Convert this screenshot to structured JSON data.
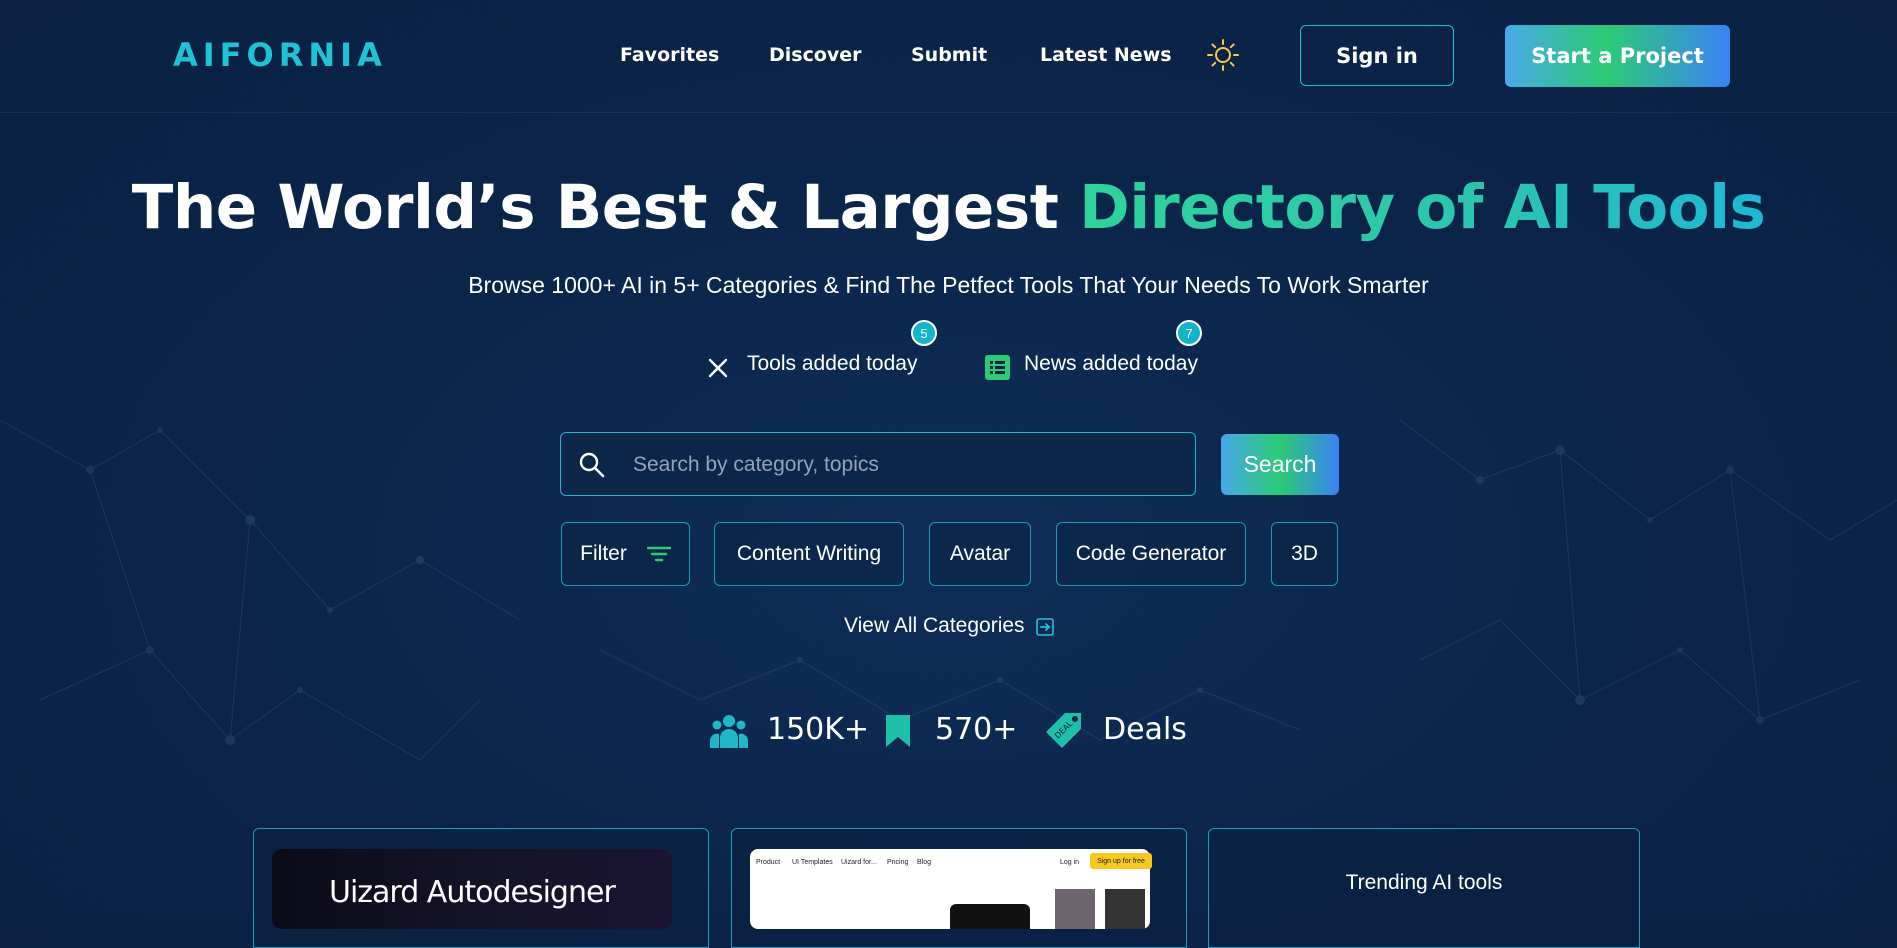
{
  "brand": {
    "logo": "AIFORNIA"
  },
  "nav": {
    "items": [
      "Favorites",
      "Discover",
      "Submit",
      "Latest News"
    ],
    "sign_in": "Sign in",
    "start_project": "Start a Project"
  },
  "hero": {
    "title_prefix": "The World’s Best & Largest ",
    "title_highlight": "Directory of AI Tools",
    "subtitle": "Browse 1000+ AI in 5+ Categories & Find The Petfect Tools That Your Needs To Work Smarter"
  },
  "today": {
    "tools_label": "Tools added today",
    "tools_count": "5",
    "news_label": "News added today",
    "news_count": "7"
  },
  "search": {
    "placeholder": "Search by category, topics",
    "button": "Search"
  },
  "chips": {
    "filter": "Filter",
    "items": [
      "Content Writing",
      "Avatar",
      "Code Generator",
      "3D"
    ]
  },
  "view_all": "View All Categories",
  "stats": {
    "users": "150K+",
    "bookmarks": "570+",
    "deals": "Deals"
  },
  "cards": {
    "card1_image_text": "Uizard Autodesigner",
    "card2_nav": [
      "Product",
      "UI Templates",
      "Uizard for...",
      "Pricing",
      "Blog"
    ],
    "card2_login": "Log in",
    "card2_signup": "Sign up for free",
    "card3_title": "Trending AI tools"
  },
  "colors": {
    "background": "#0b2448",
    "accent_cyan": "#1fc3d6",
    "accent_green": "#2ccb74",
    "accent_blue": "#3b82f6",
    "sun_icon": "#f2c94c"
  }
}
